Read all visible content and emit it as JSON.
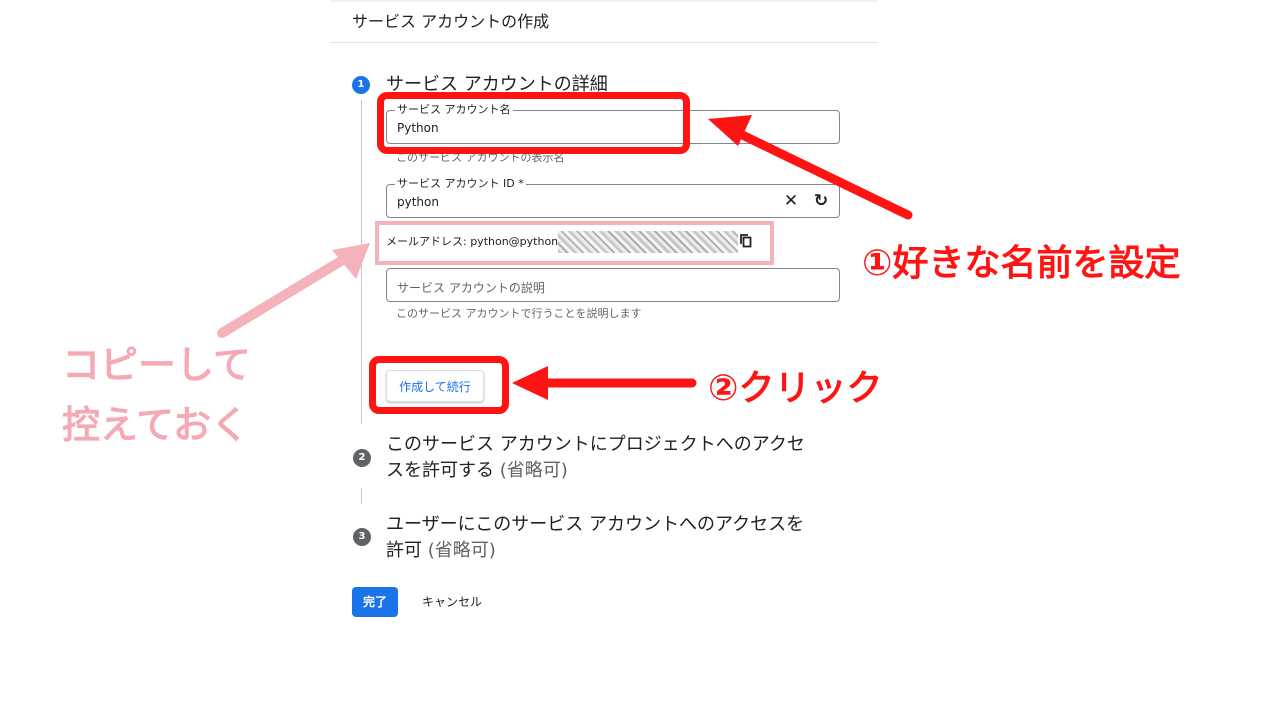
{
  "header": {
    "title": "サービス アカウントの作成"
  },
  "steps": [
    {
      "number": "1",
      "title": "サービス アカウントの詳細"
    },
    {
      "number": "2",
      "title_line1": "このサービス アカウントにプロジェクトへのアクセ",
      "title_line2": "スを許可する",
      "optional": "(省略可)"
    },
    {
      "number": "3",
      "title_line1": "ユーザーにこのサービス アカウントへのアクセスを",
      "title_line2": "許可",
      "optional": "(省略可)"
    }
  ],
  "form": {
    "name_field": {
      "label": "サービス アカウント名",
      "value": "Python",
      "helper": "このサービス アカウントの表示名"
    },
    "id_field": {
      "label": "サービス アカウント ID *",
      "value": "python"
    },
    "email": {
      "label": "メールアドレス: python@python-"
    },
    "description_field": {
      "placeholder": "サービス アカウントの説明",
      "helper": "このサービス アカウントで行うことを説明します"
    },
    "create_button": "作成して続行"
  },
  "footer": {
    "done_button": "完了",
    "cancel_button": "キャンセル"
  },
  "annotations": {
    "step1": "①好きな名前を設定",
    "step2": "②クリック",
    "copy_line1": "コピーして",
    "copy_line2": "控えておく",
    "red_color": "#ff1414",
    "pink_color": "#f4b3bb"
  }
}
